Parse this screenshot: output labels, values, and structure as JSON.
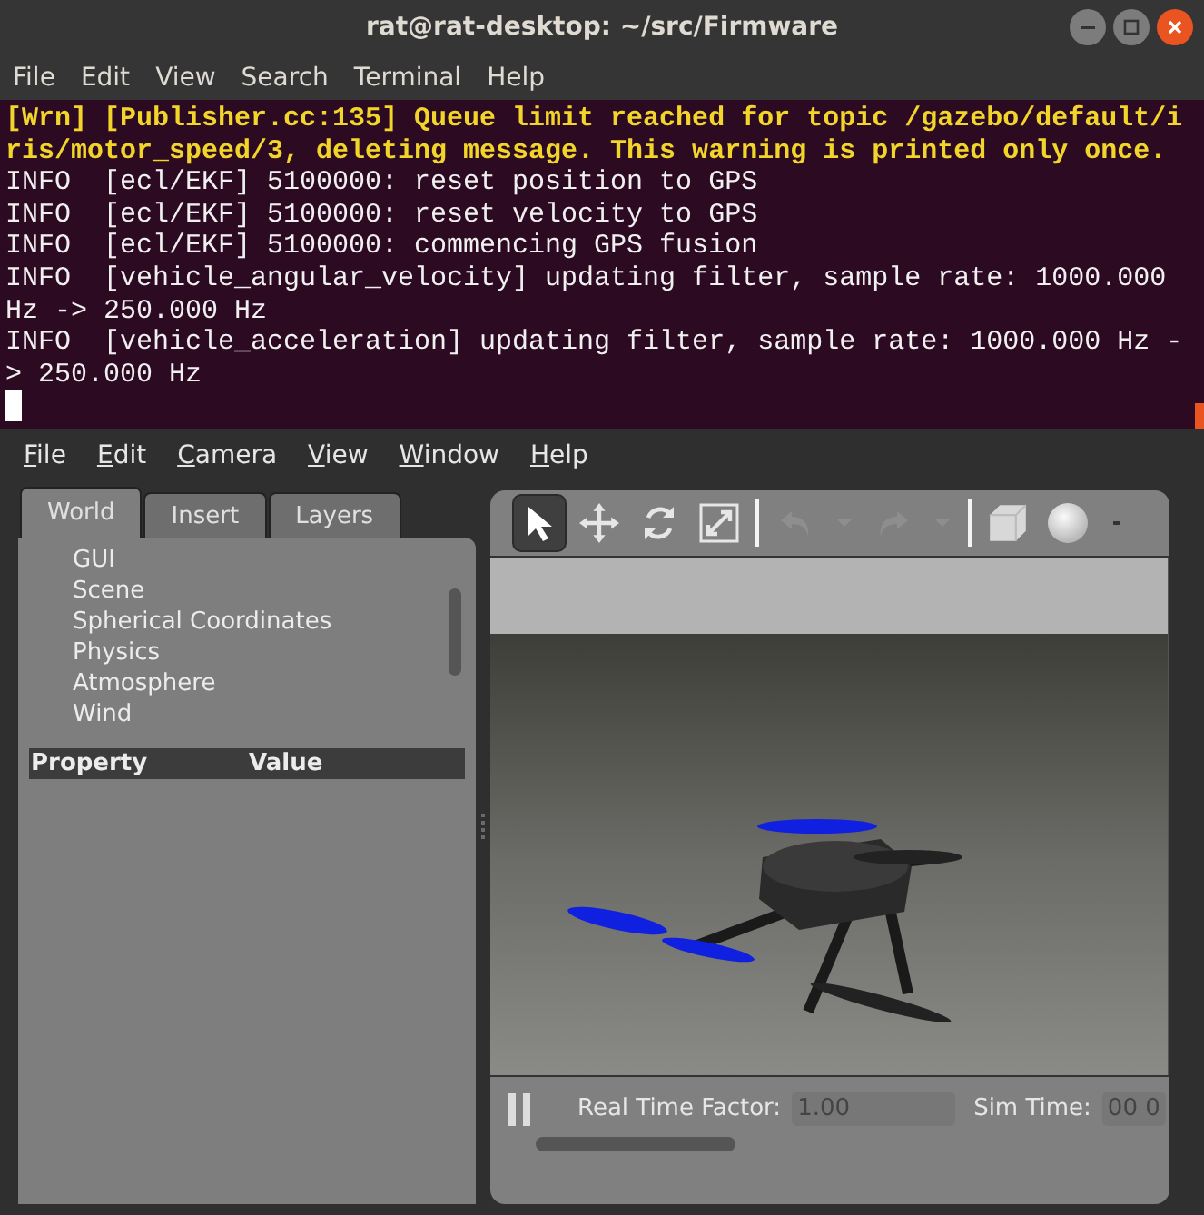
{
  "terminal": {
    "title": "rat@rat-desktop: ~/src/Firmware",
    "menu": [
      "File",
      "Edit",
      "View",
      "Search",
      "Terminal",
      "Help"
    ],
    "lines": [
      {
        "kind": "warn",
        "text": "[Wrn] [Publisher.cc:135] Queue limit reached for topic /gazebo/default/i"
      },
      {
        "kind": "warn",
        "text": "ris/motor_speed/3, deleting message. This warning is printed only once."
      },
      {
        "kind": "info",
        "text": "INFO  [ecl/EKF] 5100000: reset position to GPS"
      },
      {
        "kind": "info",
        "text": "INFO  [ecl/EKF] 5100000: reset velocity to GPS"
      },
      {
        "kind": "info",
        "text": "INFO  [ecl/EKF] 5100000: commencing GPS fusion"
      },
      {
        "kind": "info",
        "text": "INFO  [vehicle_angular_velocity] updating filter, sample rate: 1000.000"
      },
      {
        "kind": "info",
        "text": "Hz -> 250.000 Hz"
      },
      {
        "kind": "info",
        "text": "INFO  [vehicle_acceleration] updating filter, sample rate: 1000.000 Hz -"
      },
      {
        "kind": "info",
        "text": "> 250.000 Hz"
      }
    ]
  },
  "gazebo": {
    "menu": [
      "File",
      "Edit",
      "Camera",
      "View",
      "Window",
      "Help"
    ],
    "tabs": [
      {
        "label": "World",
        "selected": true
      },
      {
        "label": "Insert",
        "selected": false
      },
      {
        "label": "Layers",
        "selected": false
      }
    ],
    "tree": [
      "GUI",
      "Scene",
      "Spherical Coordinates",
      "Physics",
      "Atmosphere",
      "Wind"
    ],
    "property_header": [
      "Property",
      "Value"
    ],
    "modes": [
      {
        "kind": "select",
        "selected": true
      },
      {
        "kind": "translate",
        "selected": false
      },
      {
        "kind": "rotate",
        "selected": false
      },
      {
        "kind": "scale",
        "selected": false
      }
    ],
    "actions": [
      {
        "kind": "undo",
        "disabled": true
      },
      {
        "kind": "caret",
        "disabled": true
      },
      {
        "kind": "redo",
        "disabled": true
      },
      {
        "kind": "caret",
        "disabled": true
      }
    ],
    "shapes": [
      {
        "kind": "box"
      },
      {
        "kind": "sphere"
      },
      {
        "kind": "more"
      }
    ],
    "status": {
      "rtf_label": "Real Time Factor:",
      "rtf_value": "1.00",
      "sim_label": "Sim Time:",
      "sim_value": "00 0"
    }
  }
}
